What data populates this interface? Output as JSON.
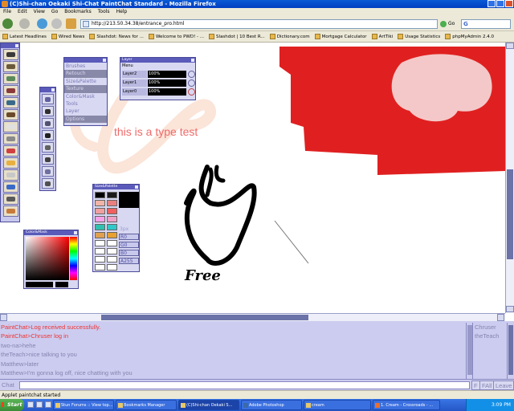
{
  "window": {
    "title": "(C)Shi-chan Oekaki Shi-Chat PaintChat Standard - Mozilla Firefox"
  },
  "menu": [
    "File",
    "Edit",
    "View",
    "Go",
    "Bookmarks",
    "Tools",
    "Help"
  ],
  "nav": {
    "url": "http://213.50.34.38/entrance_pro.html",
    "go_label": "Go"
  },
  "bookmarks": [
    "Latest Headlines",
    "Wired News",
    "Slashdot: News for ...",
    "Welcome to PWD! - ...",
    "Slashdot | 10 Best R...",
    "Dictionary.com",
    "Mortgage Calculator",
    "ArtTiki",
    "Usage Statistics",
    "phpMyAdmin 2.4.0"
  ],
  "palette": {
    "brush_menu": [
      "Brushes",
      "Retouch",
      "Size&Palette",
      "Texture",
      "Color&Mask",
      "Tools",
      "Layer",
      "Options"
    ],
    "brush_menu_selected": [
      1,
      3,
      7
    ],
    "layer": {
      "title": "Layer",
      "menu": "Menu",
      "rows": [
        {
          "name": "Layer2",
          "opacity": "100%"
        },
        {
          "name": "Layer1",
          "opacity": "100%"
        },
        {
          "name": "Layer0",
          "opacity": "100%"
        }
      ]
    },
    "size_palette": {
      "title": "Size&Palette",
      "px": "3px",
      "values": [
        "R0",
        "G0",
        "B0",
        "A255"
      ]
    },
    "color_mask": {
      "title": "Color&Mask"
    }
  },
  "canvas": {
    "type_text": "this is a type test",
    "handwriting": "Free"
  },
  "chat": {
    "log": [
      {
        "text": "PaintChat>Log received successfully.",
        "system": true
      },
      {
        "text": "PaintChat>Chruser log in",
        "system": true
      },
      {
        "text": "two-na>hehe",
        "system": false
      },
      {
        "text": "theTeach>nice talking to you",
        "system": false
      },
      {
        "text": "Matthew>later",
        "system": false
      },
      {
        "text": "Matthew>I'm gonna log off, nice chatting with you",
        "system": false
      }
    ],
    "users": [
      "Chruser",
      "theTeach"
    ],
    "input_label": "Chat",
    "buttons": [
      "F",
      "FAll",
      "Leave"
    ]
  },
  "status": "Applet paintchat started",
  "taskbar": {
    "start": "Start",
    "tasks": [
      "Stun Forums :: View top...",
      "Bookmarks Manager",
      "(C)Shi-chan Oekaki S...",
      "Adobe Photoshop",
      "cream",
      "1. Cream - Crossroads - ..."
    ],
    "active_task": 2,
    "clock": "3:09 PM"
  },
  "colors": {
    "canvas_red": "#e02020",
    "canvas_pink": "#f4c8c8",
    "type_text": "#f06a6a",
    "palette_bg": "#d8d8f2",
    "chat_system": "#ee3333"
  }
}
